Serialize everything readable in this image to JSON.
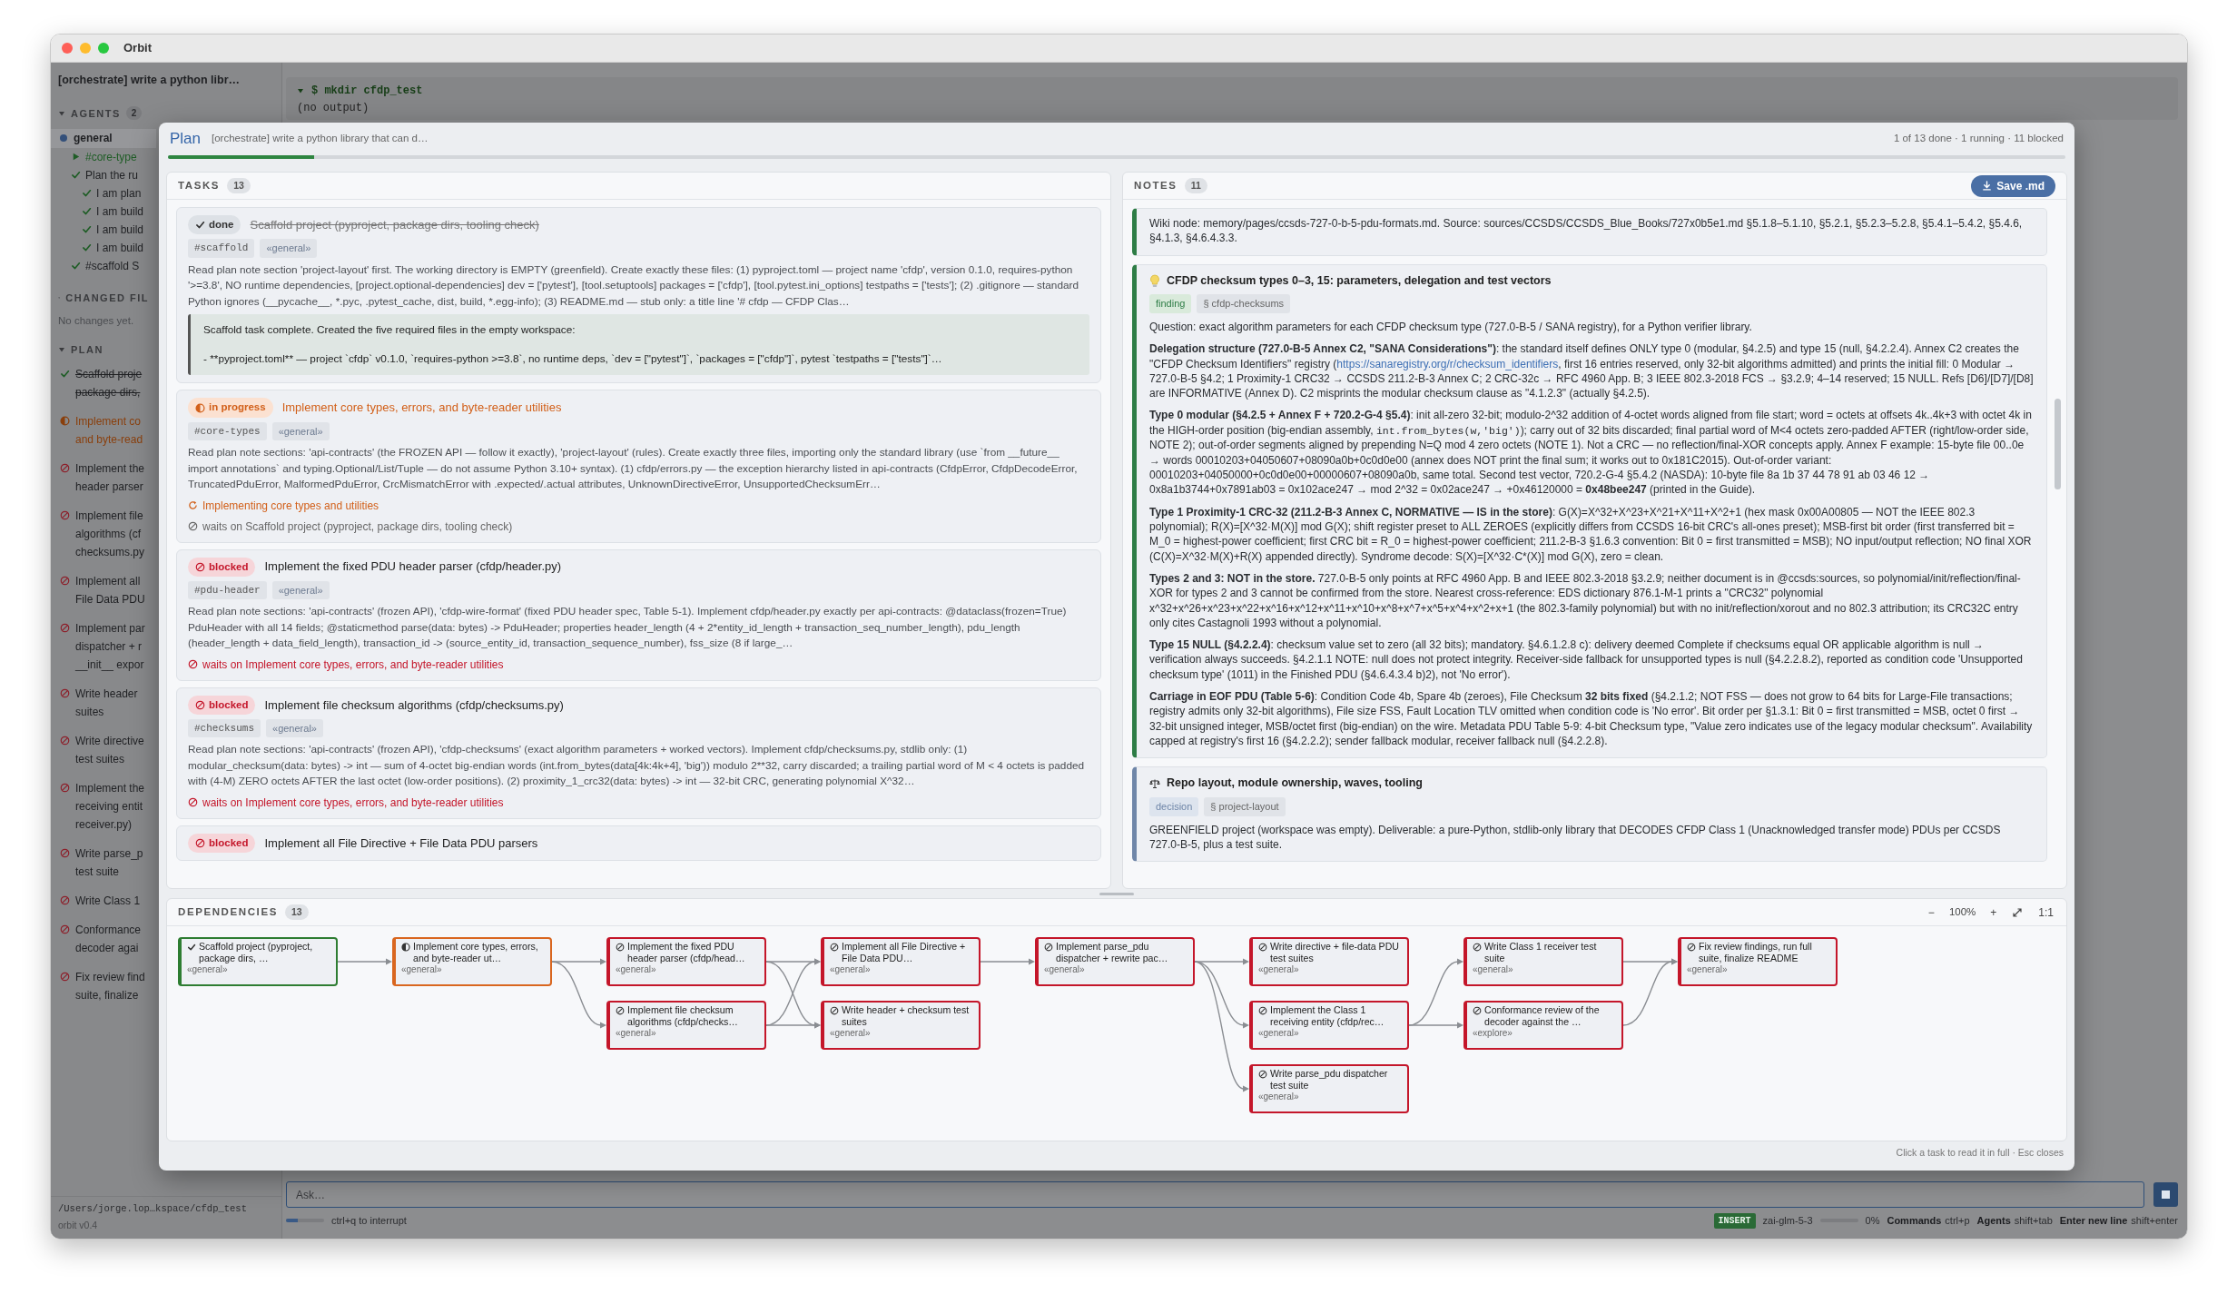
{
  "window": {
    "title": "Orbit"
  },
  "sidebar": {
    "session_title": "[orchestrate] write a python libr…",
    "agents_section": {
      "label": "AGENTS",
      "count": "2",
      "expanded": true,
      "agents": [
        {
          "name": "general",
          "selected": true,
          "children": [
            {
              "kind": "running",
              "label": "#core-type"
            },
            {
              "kind": "done",
              "label": "Plan the ru",
              "children": [
                {
                  "kind": "done",
                  "label": "I am plan"
                },
                {
                  "kind": "done",
                  "label": "I am build"
                },
                {
                  "kind": "done",
                  "label": "I am build"
                },
                {
                  "kind": "done",
                  "label": "I am build"
                }
              ]
            },
            {
              "kind": "done",
              "label": "#scaffold S"
            }
          ]
        }
      ]
    },
    "changed_files": {
      "label": "CHANGED FIL",
      "expanded": true,
      "empty_text": "No changes yet."
    },
    "plan": {
      "label": "PLAN",
      "expanded": true,
      "items": [
        {
          "kind": "done",
          "lines": [
            "Scaffold proje",
            "package dirs,"
          ]
        },
        {
          "kind": "in_progress",
          "lines": [
            "Implement co",
            "and byte-read"
          ]
        },
        {
          "kind": "blocked",
          "lines": [
            "Implement the",
            "header parser"
          ]
        },
        {
          "kind": "blocked",
          "lines": [
            "Implement file",
            "algorithms (cf",
            "checksums.py"
          ]
        },
        {
          "kind": "blocked",
          "lines": [
            "Implement all",
            "File Data PDU"
          ]
        },
        {
          "kind": "blocked",
          "lines": [
            "Implement par",
            "dispatcher + r",
            "__init__ expor"
          ]
        },
        {
          "kind": "blocked",
          "lines": [
            "Write header",
            "suites"
          ]
        },
        {
          "kind": "blocked",
          "lines": [
            "Write directive",
            "test suites"
          ]
        },
        {
          "kind": "blocked",
          "lines": [
            "Implement the",
            "receiving entit",
            "receiver.py)"
          ]
        },
        {
          "kind": "blocked",
          "lines": [
            "Write parse_p",
            "test suite"
          ]
        },
        {
          "kind": "blocked",
          "lines": [
            "Write Class 1"
          ]
        },
        {
          "kind": "blocked",
          "lines": [
            "Conformance",
            "decoder agai"
          ]
        },
        {
          "kind": "blocked",
          "lines": [
            "Fix review find",
            "suite, finalize"
          ]
        }
      ]
    },
    "cwd": "/Users/jorge.lop…kspace/cfdp_test",
    "version": "orbit v0.4"
  },
  "terminal": {
    "expanded": true,
    "command": "$ mkdir cfdp_test",
    "output": "(no output)"
  },
  "composer": {
    "placeholder": "Ask…"
  },
  "status_bar": {
    "activity": {
      "level": 0.3
    },
    "hint": "ctrl+q to interrupt",
    "mode": "INSERT",
    "model": "zai-glm-5-3",
    "context": {
      "level": 0,
      "reading": "0%"
    },
    "shortcuts": [
      {
        "label": "Commands",
        "keys": "ctrl+p"
      },
      {
        "label": "Agents",
        "keys": "shift+tab"
      },
      {
        "label": "Enter new line",
        "keys": "shift+enter"
      }
    ]
  },
  "plan_dialog": {
    "title": "Plan",
    "subtitle": "[orchestrate] write a python library that can d…",
    "summary": "1 of 13 done · 1 running · 11 blocked",
    "progress": {
      "level": 0.077
    },
    "tasks": {
      "label": "TASKS",
      "count": "13",
      "items": [
        {
          "kind": "done",
          "badge": "done",
          "title": "Scaffold project (pyproject, package dirs, tooling check)",
          "tags": [
            {
              "kind": "id",
              "text": "#scaffold"
            },
            {
              "kind": "agent",
              "text": "«general»"
            }
          ],
          "description": "Read plan note section 'project-layout' first. The working directory is EMPTY (greenfield). Create exactly these files: (1) pyproject.toml — project name 'cfdp', version 0.1.0, requires-python '>=3.8', NO runtime dependencies, [project.optional-dependencies] dev = ['pytest'], [tool.setuptools] packages = ['cfdp'], [tool.pytest.ini_options] testpaths = ['tests']; (2) .gitignore — standard Python ignores (__pycache__, *.pyc, .pytest_cache, dist, build, *.egg-info); (3) README.md — stub only: a title line '# cfdp — CFDP Clas…",
          "result": [
            "Scaffold task complete. Created the five required files in the empty workspace:",
            "- **pyproject.toml** — project `cfdp` v0.1.0, `requires-python >=3.8`, no runtime deps, `dev = [\"pytest\"]`, `packages = [\"cfdp\"]`, pytest `testpaths = [\"tests\"]`…"
          ]
        },
        {
          "kind": "in_progress",
          "badge": "in progress",
          "title": "Implement core types, errors, and byte-reader utilities",
          "tags": [
            {
              "kind": "id",
              "text": "#core-types"
            },
            {
              "kind": "agent",
              "text": "«general»"
            }
          ],
          "description": "Read plan note sections: 'api-contracts' (the FROZEN API — follow it exactly), 'project-layout' (rules). Create exactly three files, importing only the standard library (use `from __future__ import annotations` and typing.Optional/List/Tuple — do not assume Python 3.10+ syntax). (1) cfdp/errors.py — the exception hierarchy listed in api-contracts (CfdpError, CfdpDecodeError, TruncatedPduError, MalformedPduError, CrcMismatchError with .expected/.actual attributes, UnknownDirectiveError, UnsupportedChecksumErr…",
          "activity": "Implementing core types and utilities",
          "waits": "waits on Scaffold project (pyproject, package dirs, tooling check)"
        },
        {
          "kind": "blocked",
          "badge": "blocked",
          "title": "Implement the fixed PDU header parser (cfdp/header.py)",
          "tags": [
            {
              "kind": "id",
              "text": "#pdu-header"
            },
            {
              "kind": "agent",
              "text": "«general»"
            }
          ],
          "description": "Read plan note sections: 'api-contracts' (frozen API), 'cfdp-wire-format' (fixed PDU header spec, Table 5-1). Implement cfdp/header.py exactly per api-contracts: @dataclass(frozen=True) PduHeader with all 14 fields; @staticmethod parse(data: bytes) -> PduHeader; properties header_length (4 + 2*entity_id_length + transaction_seq_number_length), pdu_length (header_length + data_field_length), transaction_id -> (source_entity_id, transaction_sequence_number), fss_size (8 if large_…",
          "waits": "waits on Implement core types, errors, and byte-reader utilities"
        },
        {
          "kind": "blocked",
          "badge": "blocked",
          "title": "Implement file checksum algorithms (cfdp/checksums.py)",
          "tags": [
            {
              "kind": "id",
              "text": "#checksums"
            },
            {
              "kind": "agent",
              "text": "«general»"
            }
          ],
          "description": "Read plan note sections: 'api-contracts' (frozen API), 'cfdp-checksums' (exact algorithm parameters + worked vectors). Implement cfdp/checksums.py, stdlib only: (1) modular_checksum(data: bytes) -> int — sum of 4-octet big-endian words (int.from_bytes(data[4k:4k+4], 'big')) modulo 2**32, carry discarded; a trailing partial word of M < 4 octets is padded with (4-M) ZERO octets AFTER the last octet (low-order positions). (2) proximity_1_crc32(data: bytes) -> int — 32-bit CRC, generating polynomial X^32…",
          "waits": "waits on Implement core types, errors, and byte-reader utilities"
        },
        {
          "kind": "blocked",
          "badge": "blocked",
          "title": "Implement all File Directive + File Data PDU parsers"
        }
      ]
    },
    "notes": {
      "label": "NOTES",
      "count": "11",
      "save_button": "Save .md",
      "items": [
        {
          "kind": "source",
          "paragraphs": [
            {
              "segments": [
                {
                  "kind": "text",
                  "text": "Wiki node: memory/pages/ccsds-727-0-b-5-pdu-formats.md. Source: sources/CCSDS/CCSDS_Blue_Books/727x0b5e1.md §5.1.8–5.1.10, §5.2.1, §5.2.3–5.2.8, §5.4.1–5.4.2, §5.4.6, §4.1.3, §4.6.4.3.3."
                }
              ]
            }
          ]
        },
        {
          "kind": "finding",
          "title": "CFDP checksum types 0–3, 15: parameters, delegation and test vectors",
          "tags": [
            {
              "kind": "category",
              "text": "finding"
            },
            {
              "kind": "section",
              "text": "§ cfdp-checksums"
            }
          ],
          "paragraphs": [
            {
              "segments": [
                {
                  "kind": "text",
                  "text": "Question: exact algorithm parameters for each CFDP checksum type (727.0-B-5 / SANA registry), for a Python verifier library."
                }
              ]
            },
            {
              "segments": [
                {
                  "kind": "text",
                  "text": "**Delegation structure (727.0-B-5 Annex C2, \"SANA Considerations\")**: the standard itself defines ONLY type 0 (modular, §4.2.5) and type 15 (null, §4.2.2.4). Annex C2 creates the \"CFDP Checksum Identifiers\" registry ("
                },
                {
                  "kind": "link",
                  "text": "https://sanaregistry.org/r/checksum_identifiers"
                },
                {
                  "kind": "text",
                  "text": ", first 16 entries reserved, only 32-bit algorithms admitted) and prints the initial fill: 0 Modular → 727.0-B-5 §4.2; 1 Proximity-1 CRC32 → CCSDS 211.2-B-3 Annex C; 2 CRC-32c → RFC 4960 App. B; 3 IEEE 802.3-2018 FCS → §3.2.9; 4–14 reserved; 15 NULL. Refs [D6]/[D7]/[D8] are INFORMATIVE (Annex D). C2 misprints the modular checksum clause as \"4.1.2.3\" (actually §4.2.5)."
                }
              ]
            },
            {
              "segments": [
                {
                  "kind": "text",
                  "text": "**Type 0 modular (§4.2.5 + Annex F + 720.2-G-4 §5.4)**: init all-zero 32-bit; modulo-2^32 addition of 4-octet words aligned from file start; word = octets at offsets 4k..4k+3 with octet 4k in the HIGH-order position (big-endian assembly, "
                },
                {
                  "kind": "code",
                  "text": "int.from_bytes(w,'big')"
                },
                {
                  "kind": "text",
                  "text": "); carry out of 32 bits discarded; final partial word of M<4 octets zero-padded AFTER (right/low-order side, NOTE 2); out-of-order segments aligned by prepending N=Q mod 4 zero octets (NOTE 1). Not a CRC — no reflection/final-XOR concepts apply. Annex F example: 15-byte file 00..0e → words 00010203+04050607+08090a0b+0c0d0e00 (annex does NOT print the final sum; it works out to 0x181C2015). Out-of-order variant: 00010203+04050000+0c0d0e00+00000607+08090a0b, same total. Second test vector, 720.2-G-4 §5.4.2 (NASDA): 10-byte file 8a 1b 37 44 78 91 ab 03 46 12 → 0x8a1b3744+0x7891ab03 = 0x102ace247 → mod 2^32 = 0x02ace247 → +0x46120000 = **0x48bee247** (printed in the Guide)."
                }
              ]
            },
            {
              "segments": [
                {
                  "kind": "text",
                  "text": "**Type 1 Proximity-1 CRC-32 (211.2-B-3 Annex C, NORMATIVE — IS in the store)**: G(X)=X^32+X^23+X^21+X^11+X^2+1 (hex mask 0x00A00805 — NOT the IEEE 802.3 polynomial); R(X)=[X^32·M(X)] mod G(X); shift register preset to ALL ZEROES (explicitly differs from CCSDS 16-bit CRC's all-ones preset); MSB-first bit order (first transferred bit = M_0 = highest-power coefficient; first CRC bit = R_0 = highest-power coefficient; 211.2-B-3 §1.6.3 convention: Bit 0 = first transmitted = MSB); NO input/output reflection; NO final XOR (C(X)=X^32·M(X)+R(X) appended directly). Syndrome decode: S(X)=[X^32·C*(X)] mod G(X), zero = clean."
                }
              ]
            },
            {
              "segments": [
                {
                  "kind": "text",
                  "text": "**Types 2 and 3: NOT in the store.** 727.0-B-5 only points at RFC 4960 App. B and IEEE 802.3-2018 §3.2.9; neither document is in @ccsds:sources, so polynomial/init/reflection/final-XOR for types 2 and 3 cannot be confirmed from the store. Nearest cross-reference: EDS dictionary 876.1-M-1 prints a \"CRC32\" polynomial x^32+x^26+x^23+x^22+x^16+x^12+x^11+x^10+x^8+x^7+x^5+x^4+x^2+x+1 (the 802.3-family polynomial) but with no init/reflection/xorout and no 802.3 attribution; its CRC32C entry only cites Castagnoli 1993 without a polynomial."
                }
              ]
            },
            {
              "segments": [
                {
                  "kind": "text",
                  "text": "**Type 15 NULL (§4.2.2.4)**: checksum value set to zero (all 32 bits); mandatory. §4.6.1.2.8 c): delivery deemed Complete if checksums equal OR applicable algorithm is null → verification always succeeds. §4.2.1.1 NOTE: null does not protect integrity. Receiver-side fallback for unsupported types is null (§4.2.2.8.2), reported as condition code 'Unsupported checksum type' (1011) in the Finished PDU (§4.6.4.3.4 b)2), not 'No error')."
                }
              ]
            },
            {
              "segments": [
                {
                  "kind": "text",
                  "text": "**Carriage in EOF PDU (Table 5-6)**: Condition Code 4b, Spare 4b (zeroes), File Checksum **32 bits fixed** (§4.2.1.2; NOT FSS — does not grow to 64 bits for Large-File transactions; registry admits only 32-bit algorithms), File size FSS, Fault Location TLV omitted when condition code is 'No error'. Bit order per §1.3.1: Bit 0 = first transmitted = MSB, octet 0 first → 32-bit unsigned integer, MSB/octet first (big-endian) on the wire. Metadata PDU Table 5-9: 4-bit Checksum type, \"Value zero indicates use of the legacy modular checksum\". Availability capped at registry's first 16 (§4.2.2.2); sender fallback modular, receiver fallback null (§4.2.2.8)."
                }
              ]
            }
          ]
        },
        {
          "kind": "decision",
          "title": "Repo layout, module ownership, waves, tooling",
          "tags": [
            {
              "kind": "category",
              "text": "decision"
            },
            {
              "kind": "section",
              "text": "§ project-layout"
            }
          ],
          "paragraphs": [
            {
              "segments": [
                {
                  "kind": "text",
                  "text": "GREENFIELD project (workspace was empty). Deliverable: a pure-Python, stdlib-only library that DECODES CFDP Class 1 (Unacknowledged transfer mode) PDUs per CCSDS 727.0-B-5, plus a test suite."
                }
              ]
            }
          ]
        }
      ]
    },
    "dependencies": {
      "label": "DEPENDENCIES",
      "count": "13",
      "zoom_out": "−",
      "zoom": "100%",
      "zoom_in": "+",
      "actual_size": "1:1",
      "columns": [
        [
          {
            "kind": "done",
            "title": "Scaffold project (pyproject, package dirs, …",
            "tag": "«general»",
            "links": [
              true
            ]
          }
        ],
        [
          {
            "kind": "in_progress",
            "title": "Implement core types, errors, and byte-reader ut…",
            "tag": "«general»",
            "links": [
              true,
              true
            ]
          }
        ],
        [
          {
            "kind": "blocked",
            "title": "Implement the fixed PDU header parser (cfdp/head…",
            "tag": "«general»",
            "links": [
              true,
              true
            ]
          },
          {
            "kind": "blocked",
            "title": "Implement file checksum algorithms (cfdp/checks…",
            "tag": "«general»",
            "links": [
              true,
              true
            ]
          }
        ],
        [
          {
            "kind": "blocked",
            "title": "Implement all File Directive + File Data PDU…",
            "tag": "«general»",
            "links": [
              true
            ]
          },
          {
            "kind": "blocked",
            "title": "Write header + checksum test suites",
            "tag": "«general»"
          }
        ],
        [
          {
            "kind": "blocked",
            "title": "Implement parse_pdu dispatcher + rewrite pac…",
            "tag": "«general»",
            "links": [
              true,
              true,
              true
            ]
          }
        ],
        [
          {
            "kind": "blocked",
            "title": "Write directive + file-data PDU test suites",
            "tag": "«general»"
          },
          {
            "kind": "blocked",
            "title": "Implement the Class 1 receiving entity (cfdp/rec…",
            "tag": "«general»",
            "links": [
              true,
              true
            ]
          },
          {
            "kind": "blocked",
            "title": "Write parse_pdu dispatcher test suite",
            "tag": "«general»"
          }
        ],
        [
          {
            "kind": "blocked",
            "title": "Write Class 1 receiver test suite",
            "tag": "«general»",
            "links": [
              true
            ]
          },
          {
            "kind": "blocked",
            "title": "Conformance review of the decoder against the …",
            "tag": "«explore»",
            "links": [
              true
            ]
          }
        ],
        [
          {
            "kind": "blocked",
            "title": "Fix review findings, run full suite, finalize README",
            "tag": "«general»"
          }
        ]
      ]
    },
    "footer": "Click a task to read it in full · Esc closes"
  }
}
